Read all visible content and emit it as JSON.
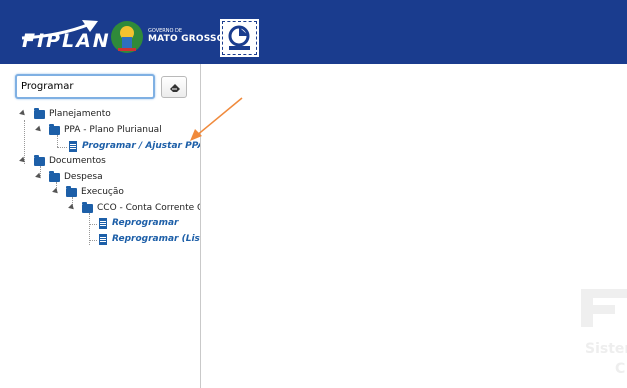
{
  "header": {
    "logo_text": "FIPLAN",
    "gov_small": "GOVERNO DE",
    "gov_state": "MATO GROSSO",
    "stamp_icon": "fiplan-stamp-icon",
    "bg_color": "#1a3c8e"
  },
  "search": {
    "value": "Programar",
    "clear_icon": "eraser-icon"
  },
  "tree": {
    "planejamento": "Planejamento",
    "ppa": "PPA - Plano Plurianual",
    "programar_ajustar": "Programar / Ajustar PPA",
    "documentos": "Documentos",
    "despesa": "Despesa",
    "execucao": "Execução",
    "cco": "CCO - Conta Corrente O",
    "reprogramar": "Reprogramar",
    "reprogramar_list": "Reprogramar (List"
  },
  "watermark": {
    "line1": "Sister",
    "line2": "C"
  },
  "colors": {
    "accent": "#1d5fa8",
    "annotation_arrow": "#f08a3c"
  }
}
